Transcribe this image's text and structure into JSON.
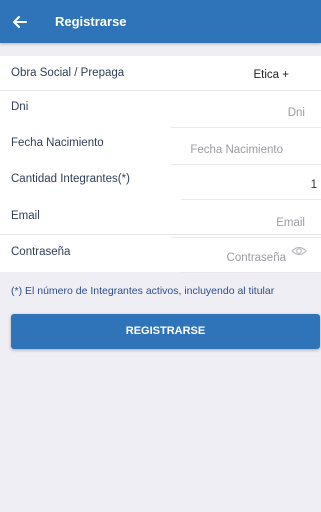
{
  "header": {
    "title": "Registrarse",
    "back_icon": "arrow-left-icon"
  },
  "form": {
    "obra_social": {
      "label": "Obra Social / Prepaga",
      "value": "Etica +"
    },
    "dni": {
      "label": "Dni",
      "placeholder": "Dni"
    },
    "fecha_nacimiento": {
      "label": "Fecha Nacimiento",
      "placeholder": "Fecha Nacimiento"
    },
    "cantidad_integrantes": {
      "label": "Cantidad Integrantes(*)",
      "value": "1"
    },
    "email": {
      "label": "Email",
      "placeholder": "Email"
    },
    "contrasena": {
      "label": "Contraseña",
      "placeholder": "Contraseña",
      "toggle_icon": "eye-icon"
    }
  },
  "note": "(*) El número de Integrantes activos, incluyendo al titular",
  "submit_label": "REGISTRARSE",
  "colors": {
    "primary": "#2f74b8",
    "background": "#efeef4",
    "label_text": "#2f3f57",
    "note_text": "#2b4f8c"
  }
}
